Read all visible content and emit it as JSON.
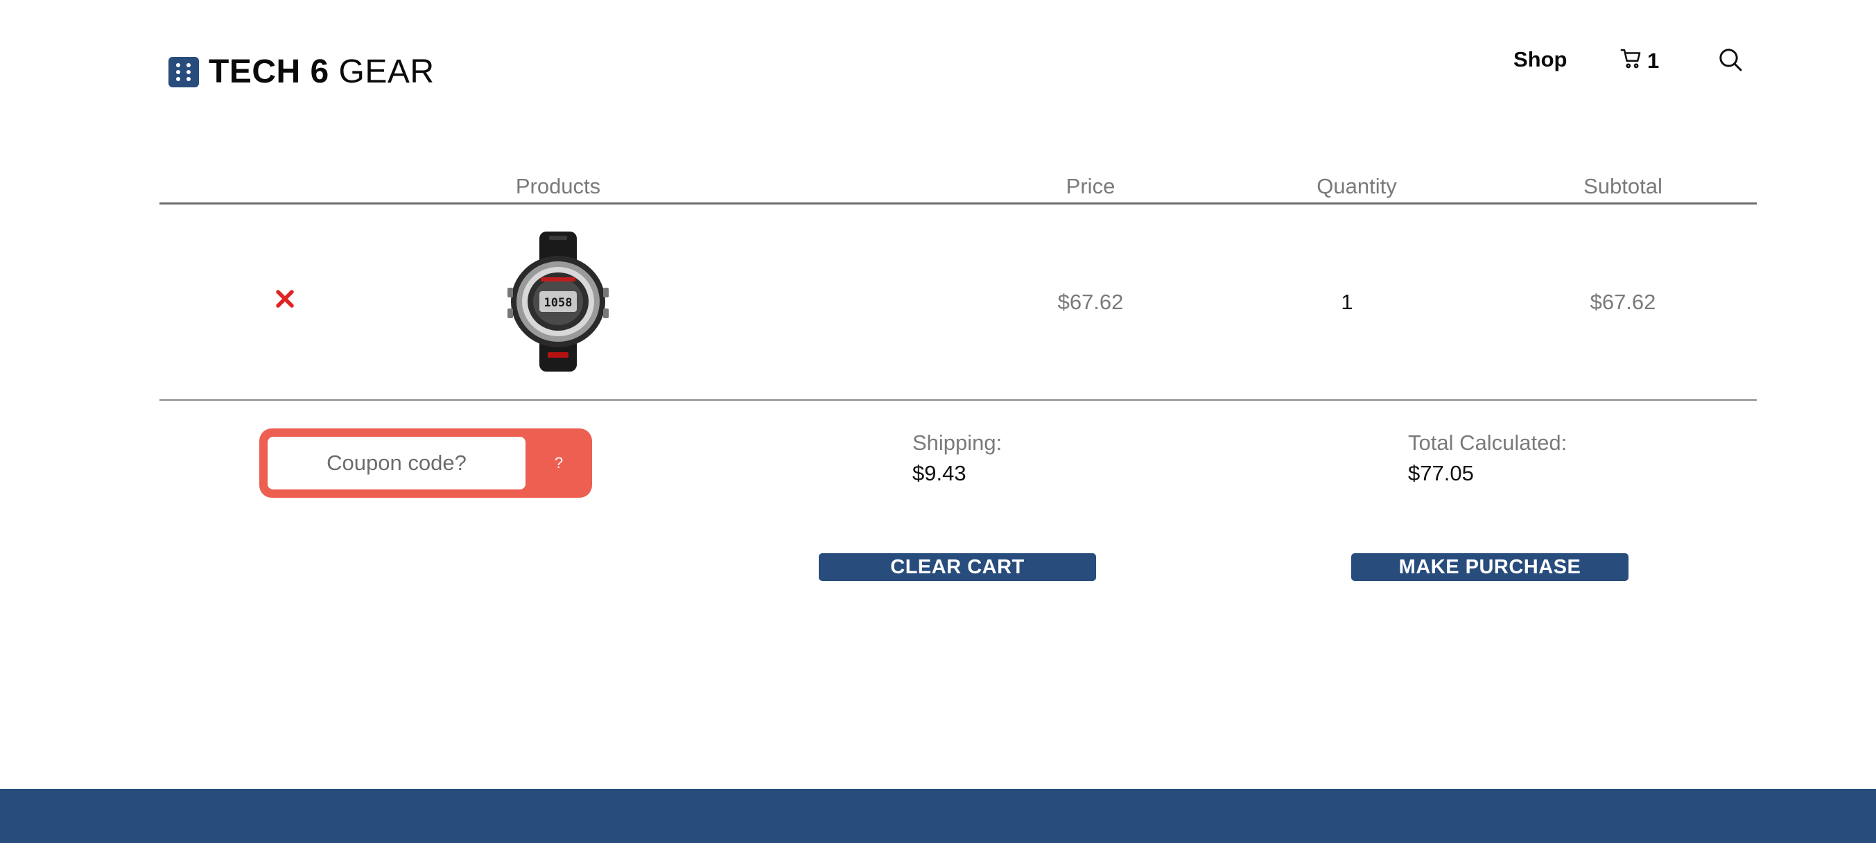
{
  "brand": {
    "bold": "TECH 6",
    "light": "GEAR"
  },
  "nav": {
    "shop": "Shop",
    "cart_count": "1"
  },
  "table": {
    "headers": {
      "products": "Products",
      "price": "Price",
      "quantity": "Quantity",
      "subtotal": "Subtotal"
    },
    "rows": [
      {
        "product": "Digital sport watch",
        "price": "$67.62",
        "quantity": "1",
        "subtotal": "$67.62"
      }
    ]
  },
  "coupon": {
    "placeholder": "Coupon code?",
    "help": "?"
  },
  "summary": {
    "shipping_label": "Shipping:",
    "shipping_value": "$9.43",
    "total_label": "Total Calculated:",
    "total_value": "$77.05"
  },
  "actions": {
    "clear": "CLEAR CART",
    "purchase": "MAKE PURCHASE"
  },
  "colors": {
    "brand": "#284c7c",
    "coupon": "#ec5f51",
    "remove": "#e02424"
  }
}
